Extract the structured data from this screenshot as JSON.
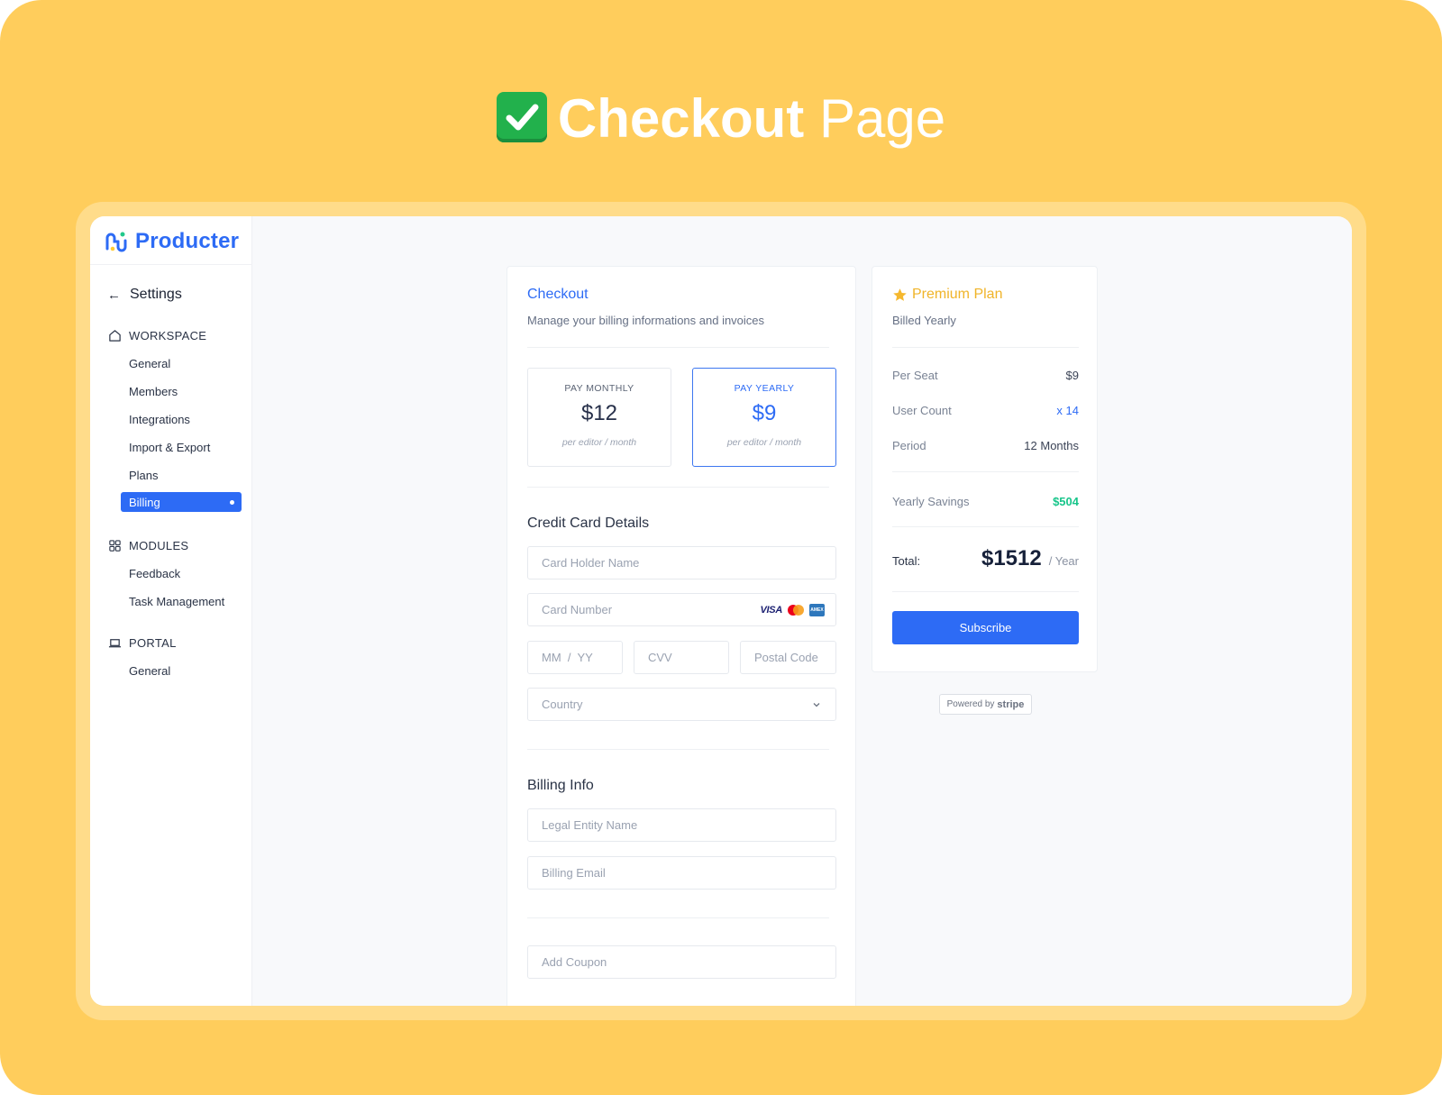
{
  "headline": {
    "emoji": "✅",
    "bold": "Checkout",
    "light": "Page"
  },
  "brand": {
    "name": "Producter"
  },
  "sidebar": {
    "back_label": "Settings",
    "sections": [
      {
        "title": "WORKSPACE",
        "items": [
          "General",
          "Members",
          "Integrations",
          "Import & Export",
          "Plans",
          "Billing"
        ]
      },
      {
        "title": "MODULES",
        "items": [
          "Feedback",
          "Task Management"
        ]
      },
      {
        "title": "PORTAL",
        "items": [
          "General"
        ]
      }
    ],
    "active_item": "Billing"
  },
  "checkout": {
    "title": "Checkout",
    "subtitle": "Manage your billing informations and invoices",
    "options": [
      {
        "label": "PAY MONTHLY",
        "price": "$12",
        "per": "per editor / month",
        "selected": false
      },
      {
        "label": "PAY YEARLY",
        "price": "$9",
        "per": "per editor / month",
        "selected": true
      }
    ],
    "card_section_title": "Credit Card Details",
    "placeholders": {
      "holder": "Card Holder Name",
      "number": "Card Number",
      "expiry": "MM  /  YY",
      "cvv": "CVV",
      "postal": "Postal Code",
      "country": "Country",
      "legal": "Legal Entity Name",
      "email": "Billing Email",
      "coupon": "Add Coupon"
    },
    "card_brands": {
      "visa": "VISA",
      "amex": "AMEX"
    },
    "billing_section_title": "Billing Info"
  },
  "plan": {
    "title": "Premium Plan",
    "subtitle": "Billed Yearly",
    "rows": [
      {
        "label": "Per Seat",
        "value": "$9"
      },
      {
        "label": "User Count",
        "value": "x 14"
      },
      {
        "label": "Period",
        "value": "12 Months"
      }
    ],
    "savings": {
      "label": "Yearly Savings",
      "value": "$504"
    },
    "total": {
      "label": "Total:",
      "value": "$1512",
      "unit": "/ Year"
    },
    "subscribe_label": "Subscribe"
  },
  "stripe": {
    "prefix": "Powered by",
    "brand": "stripe"
  },
  "colors": {
    "accent": "#2d6bf5",
    "background": "#ffcd5c",
    "savings": "#17c58a",
    "star": "#f5b82e"
  }
}
